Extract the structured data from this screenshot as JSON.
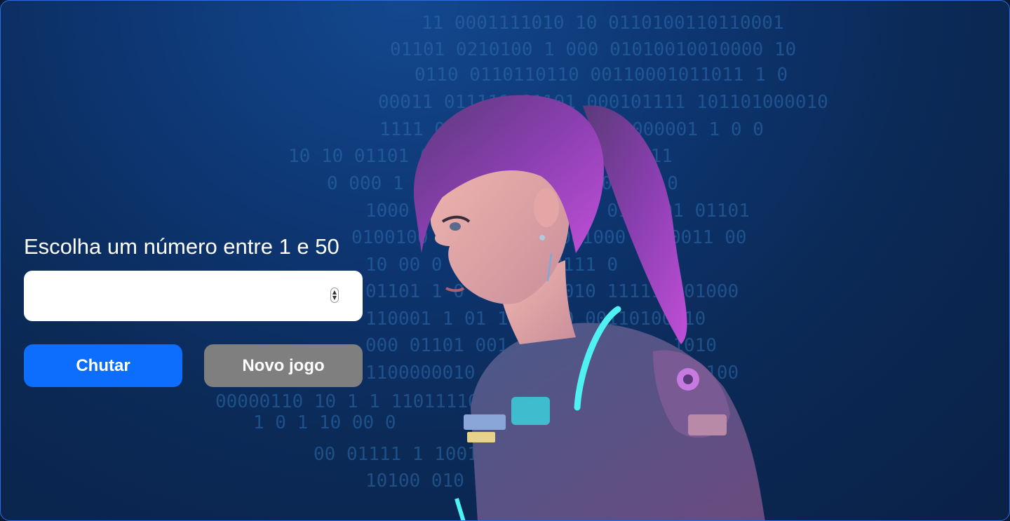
{
  "game": {
    "prompt": "Escolha um número entre 1 e 50",
    "input_value": "",
    "guess_button": "Chutar",
    "new_game_button": "Novo jogo"
  },
  "binary_lines": [
    "11 0001111010 10 0110100110110001",
    "01101 0210100  1   000 01010010010000 10",
    "0110 0110110110   00110001011011 1 0",
    "00011  011111 01101 000101111  101101000010",
    "1111  0010 1011101000011000001 1 0 0",
    "10 10 01101   01 1001 1 01 100 001011",
    "0  000 1 11   011 1000 1 1  001 10 0",
    "1000  00101  111110 011 0100001 01101",
    "0100100  1011111010 001000  0100011 00",
    "10 00  0 10 0011110111   0",
    "01101  1 0 01 11110010 111111 01000",
    "110001 1 01 1 00110 00110100110",
    "000  01101 001 1110010111000 1010",
    "1100000010 011  10 0000011 1 11 100",
    "00000110 10  1 1  110111101000 10 0",
    "1  0 1   10 00 0",
    "00 01111  1  100101 11011",
    "10100 010  01110 010 0110 0"
  ],
  "colors": {
    "accent": "#0d6efd",
    "secondary_button": "#7f7f7f",
    "background": "#0b2a57"
  },
  "icons": {
    "spinner_up": "▲",
    "spinner_down": "▼"
  }
}
